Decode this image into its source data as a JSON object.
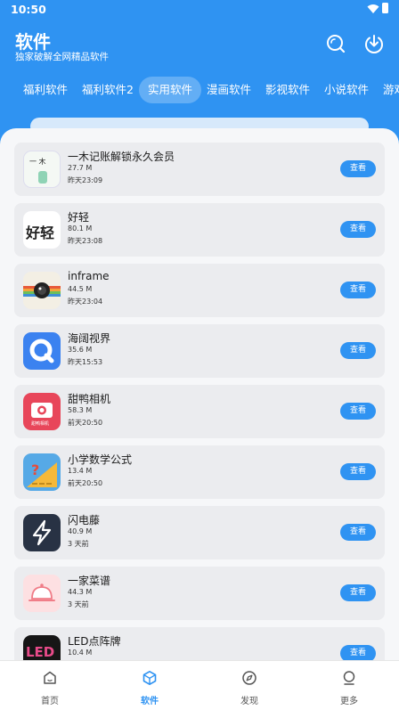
{
  "status_bar": {
    "time": "10:50"
  },
  "header": {
    "title": "软件",
    "subtitle": "独家破解全网精品软件",
    "icons": [
      "search-icon",
      "download-icon"
    ]
  },
  "tabs": [
    {
      "label": "福利软件",
      "active": false
    },
    {
      "label": "福利软件2",
      "active": false
    },
    {
      "label": "实用软件",
      "active": true
    },
    {
      "label": "漫画软件",
      "active": false
    },
    {
      "label": "影视软件",
      "active": false
    },
    {
      "label": "小说软件",
      "active": false
    },
    {
      "label": "游戏",
      "active": false
    }
  ],
  "apps": [
    {
      "name": "一木记账解锁永久会员",
      "size": "27.7 M",
      "time": "昨天23:09",
      "button": "查看",
      "icon_text": "一 木"
    },
    {
      "name": "好轻",
      "size": "80.1 M",
      "time": "昨天23:08",
      "button": "查看",
      "icon_text": "好轻"
    },
    {
      "name": "inframe",
      "size": "44.5 M",
      "time": "昨天23:04",
      "button": "查看"
    },
    {
      "name": "海阔视界",
      "size": "35.6 M",
      "time": "昨天15:53",
      "button": "查看"
    },
    {
      "name": "甜鸭相机",
      "size": "58.3 M",
      "time": "前天20:50",
      "button": "查看",
      "icon_text": "甜鸭相机"
    },
    {
      "name": "小学数学公式",
      "size": "13.4 M",
      "time": "前天20:50",
      "button": "查看"
    },
    {
      "name": "闪电藤",
      "size": "40.9 M",
      "time": "3 天前",
      "button": "查看"
    },
    {
      "name": "一家菜谱",
      "size": "44.3 M",
      "time": "3 天前",
      "button": "查看"
    },
    {
      "name": "LED点阵牌",
      "size": "10.4 M",
      "time": "",
      "button": "查看",
      "icon_text": "LED"
    }
  ],
  "bottom_nav": [
    {
      "label": "首页",
      "icon": "home-icon",
      "active": false
    },
    {
      "label": "软件",
      "icon": "cube-icon",
      "active": true
    },
    {
      "label": "发现",
      "icon": "compass-icon",
      "active": false
    },
    {
      "label": "更多",
      "icon": "user-icon",
      "active": false
    }
  ],
  "colors": {
    "primary": "#2f93f2",
    "card": "#ebecef",
    "background": "#f6f7f9"
  }
}
